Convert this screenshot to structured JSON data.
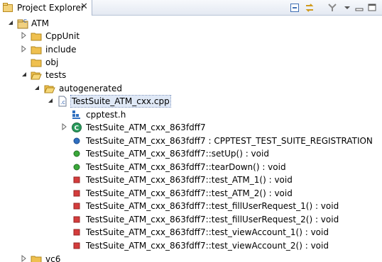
{
  "view": {
    "title": "Project Explorer",
    "close": "✕"
  },
  "tree": {
    "atm": "ATM",
    "cppunit": "CppUnit",
    "include": "include",
    "obj": "obj",
    "tests": "tests",
    "autogenerated": "autogenerated",
    "testsuite_file": "TestSuite_ATM_cxx.cpp",
    "cpptest_h": "cpptest.h",
    "class_node": "TestSuite_ATM_cxx_863fdff7",
    "registration": "TestSuite_ATM_cxx_863fdff7 : CPPTEST_TEST_SUITE_REGISTRATION",
    "setup": "TestSuite_ATM_cxx_863fdff7::setUp() : void",
    "teardown": "TestSuite_ATM_cxx_863fdff7::tearDown() : void",
    "test_atm_1": "TestSuite_ATM_cxx_863fdff7::test_ATM_1() : void",
    "test_atm_2": "TestSuite_ATM_cxx_863fdff7::test_ATM_2() : void",
    "test_fill_1": "TestSuite_ATM_cxx_863fdff7::test_fillUserRequest_1() : void",
    "test_fill_2": "TestSuite_ATM_cxx_863fdff7::test_fillUserRequest_2() : void",
    "test_view_1": "TestSuite_ATM_cxx_863fdff7::test_viewAccount_1() : void",
    "test_view_2": "TestSuite_ATM_cxx_863fdff7::test_viewAccount_2() : void",
    "vc6": "vc6"
  },
  "icons": {
    "folder": "folder-icon",
    "project": "cpp-project-icon",
    "source_file": "cpp-source-file-icon",
    "include_file": "include-file-icon",
    "class": "class-icon",
    "public_member": "public-member-icon",
    "public_method": "public-method-icon",
    "private_method": "private-method-icon"
  },
  "colors": {
    "folder": "#e9b94a",
    "public_member": "#2f6fc0",
    "public_method": "#3aa83a",
    "private_method": "#d43c3c",
    "class": "#2a9a5c",
    "selection": "#dfe8f6"
  }
}
